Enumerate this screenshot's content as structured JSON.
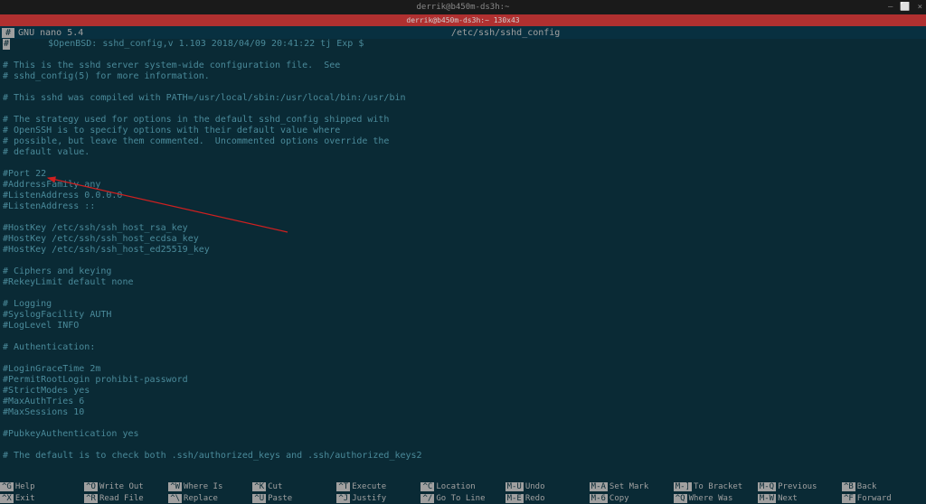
{
  "titlebar": {
    "title": "derrik@b450m-ds3h:~",
    "minimize": "–",
    "maximize": "⬜",
    "close": "×"
  },
  "red_band": "derrik@b450m-ds3h:~ 130x43",
  "nano": {
    "gutter_mark": "#",
    "version": "GNU nano 5.4",
    "file_path": "/etc/ssh/sshd_config"
  },
  "file_lines": [
    "#       $OpenBSD: sshd_config,v 1.103 2018/04/09 20:41:22 tj Exp $",
    "",
    "# This is the sshd server system-wide configuration file.  See",
    "# sshd_config(5) for more information.",
    "",
    "# This sshd was compiled with PATH=/usr/local/sbin:/usr/local/bin:/usr/bin",
    "",
    "# The strategy used for options in the default sshd_config shipped with",
    "# OpenSSH is to specify options with their default value where",
    "# possible, but leave them commented.  Uncommented options override the",
    "# default value.",
    "",
    "#Port 22",
    "#AddressFamily any",
    "#ListenAddress 0.0.0.0",
    "#ListenAddress ::",
    "",
    "#HostKey /etc/ssh/ssh_host_rsa_key",
    "#HostKey /etc/ssh/ssh_host_ecdsa_key",
    "#HostKey /etc/ssh/ssh_host_ed25519_key",
    "",
    "# Ciphers and keying",
    "#RekeyLimit default none",
    "",
    "# Logging",
    "#SyslogFacility AUTH",
    "#LogLevel INFO",
    "",
    "# Authentication:",
    "",
    "#LoginGraceTime 2m",
    "#PermitRootLogin prohibit-password",
    "#StrictModes yes",
    "#MaxAuthTries 6",
    "#MaxSessions 10",
    "",
    "#PubkeyAuthentication yes",
    "",
    "# The default is to check both .ssh/authorized_keys and .ssh/authorized_keys2"
  ],
  "shortcuts": {
    "row1": [
      {
        "key": "^G",
        "label": "Help"
      },
      {
        "key": "^O",
        "label": "Write Out"
      },
      {
        "key": "^W",
        "label": "Where Is"
      },
      {
        "key": "^K",
        "label": "Cut"
      },
      {
        "key": "^T",
        "label": "Execute"
      },
      {
        "key": "^C",
        "label": "Location"
      },
      {
        "key": "M-U",
        "label": "Undo"
      },
      {
        "key": "M-A",
        "label": "Set Mark"
      },
      {
        "key": "M-]",
        "label": "To Bracket"
      },
      {
        "key": "M-Q",
        "label": "Previous"
      },
      {
        "key": "^B",
        "label": "Back"
      }
    ],
    "row2": [
      {
        "key": "^X",
        "label": "Exit"
      },
      {
        "key": "^R",
        "label": "Read File"
      },
      {
        "key": "^\\",
        "label": "Replace"
      },
      {
        "key": "^U",
        "label": "Paste"
      },
      {
        "key": "^J",
        "label": "Justify"
      },
      {
        "key": "^/",
        "label": "Go To Line"
      },
      {
        "key": "M-E",
        "label": "Redo"
      },
      {
        "key": "M-6",
        "label": "Copy"
      },
      {
        "key": "^Q",
        "label": "Where Was"
      },
      {
        "key": "M-W",
        "label": "Next"
      },
      {
        "key": "^F",
        "label": "Forward"
      }
    ]
  }
}
